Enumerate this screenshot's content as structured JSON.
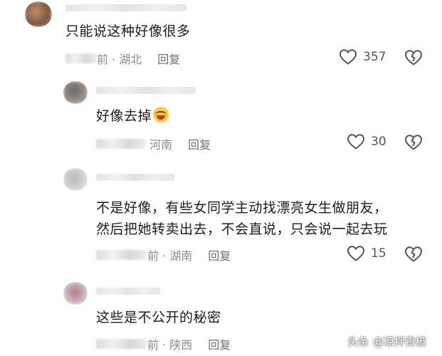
{
  "comments": [
    {
      "text": "只能说这种好像很多",
      "time_suffix": "前",
      "location": "湖北",
      "reply_label": "回复",
      "likes": "357"
    },
    {
      "text": "好像去掉",
      "emoji": "laughing-crying-emoji",
      "location": "河南",
      "reply_label": "回复",
      "likes": "30"
    },
    {
      "text_line1": "不是好像，有些女同学主动找漂亮女生做朋友，",
      "text_line2": "然后把她转卖出去，不会直说，只会说一起去玩",
      "time_suffix": "前",
      "location": "湖南",
      "reply_label": "回复",
      "likes": "15"
    },
    {
      "text": "这些是不公开的秘密",
      "time_suffix": "前",
      "location": "陕西",
      "reply_label": "回复"
    }
  ],
  "watermark": {
    "prefix": "头条",
    "handle": "@凉拌青椒"
  },
  "icons": {
    "like": "heart-outline-icon",
    "dislike": "broken-heart-icon"
  },
  "colors": {
    "text": "#1c1c1c",
    "meta": "#8a8a8a",
    "icon": "#555555"
  }
}
